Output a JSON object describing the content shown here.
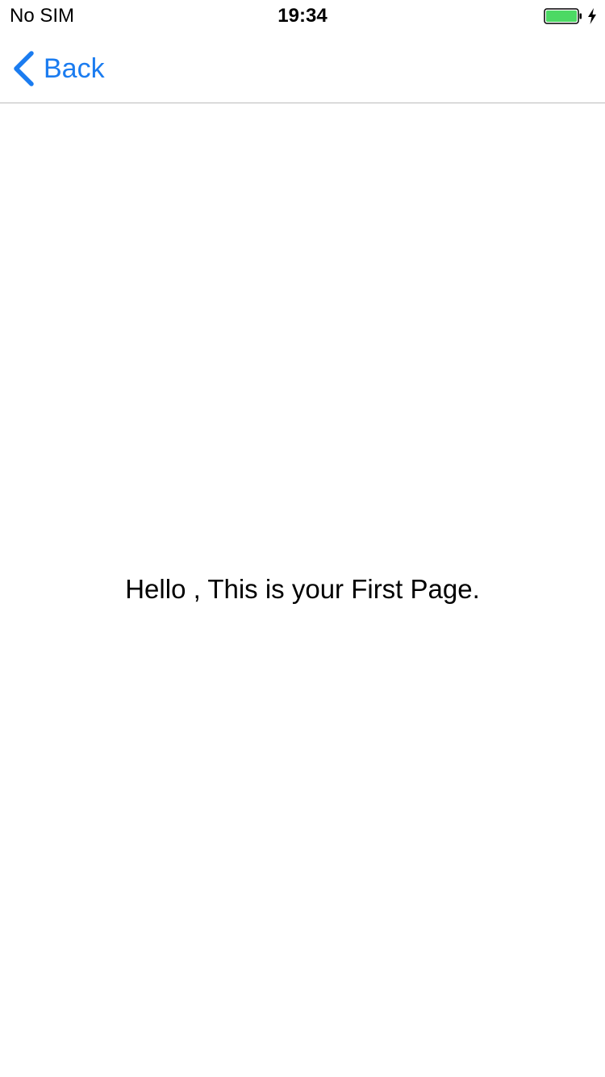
{
  "status_bar": {
    "carrier": "No SIM",
    "time": "19:34",
    "battery_level": 1.0,
    "battery_color": "#4cd964",
    "charging_icon": "bolt-icon"
  },
  "nav_bar": {
    "back_label": "Back",
    "back_icon": "chevron-left-icon",
    "accent_color": "#1b7cf0"
  },
  "content": {
    "message": "Hello , This is your First Page."
  }
}
